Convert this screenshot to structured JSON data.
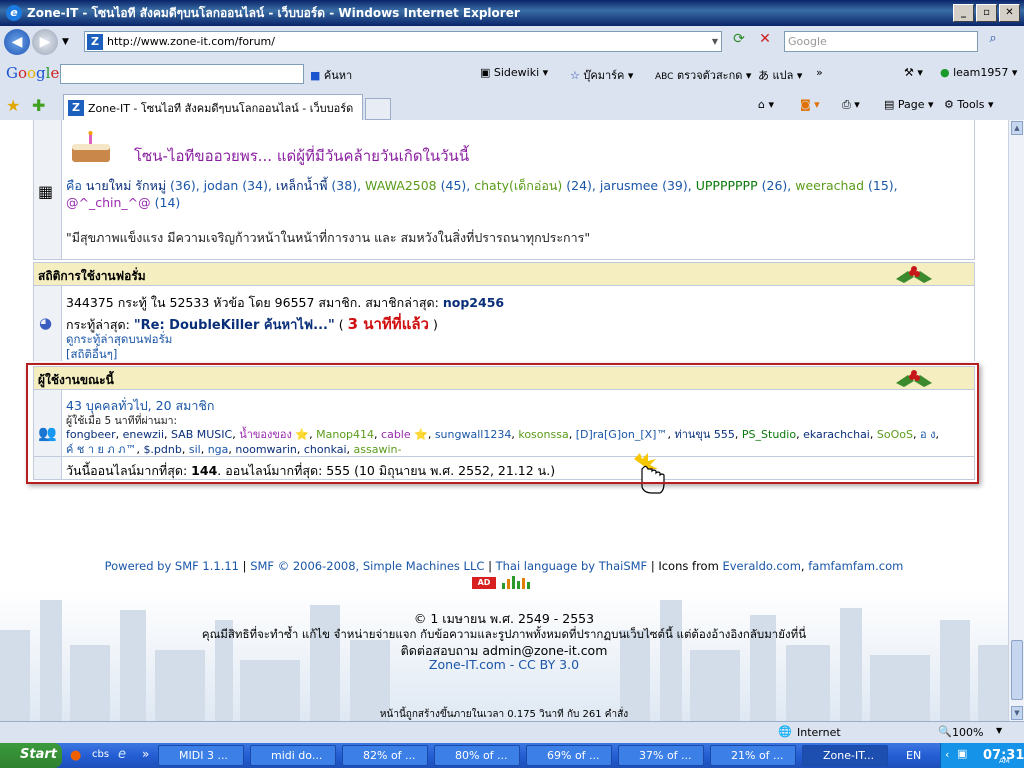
{
  "window": {
    "title": "Zone-IT - โซนไอที สังคมดีๆบนโลกออนไลน์ - เว็บบอร์ด - Windows Internet Explorer",
    "btns": [
      "_",
      "▫",
      "✕"
    ]
  },
  "address": {
    "url": "http://www.zone-it.com/forum/",
    "search_placeholder": "Google"
  },
  "gbar": {
    "logo": [
      "G",
      "o",
      "o",
      "g",
      "l",
      "e"
    ],
    "search": "ค้นหา",
    "sidewiki": "Sidewiki",
    "bookmarks": "บุ๊คมาร์ค",
    "spell": "ตรวจตัวสะกด",
    "translate": "แปล",
    "more": "»",
    "user": "leam1957"
  },
  "tabs": {
    "active": "Zone-IT - โซนไอที สังคมดีๆบนโลกออนไลน์ - เว็บบอร์ด",
    "page": "Page",
    "tools": "Tools"
  },
  "birthday": {
    "heading": "โซน-ไอทีขออวยพร... แด่ผู้ที่มีวันคล้ายวันเกิดในวันนี้",
    "intro": "คือ",
    "names": [
      {
        "t": "นายใหม่ รักหมู่",
        "n": "(36)",
        "c": "navy"
      },
      {
        "t": "jodan",
        "n": "(34)",
        "c": "link"
      },
      {
        "t": "เหล็กน้ำพี้",
        "n": "(38)",
        "c": "navy"
      },
      {
        "t": "WAWA2508",
        "n": "(45)",
        "c": "green"
      },
      {
        "t": "chaty(เด็กอ่อน)",
        "n": "(24)",
        "c": "green"
      },
      {
        "t": "jarusmee",
        "n": "(39)",
        "c": "link"
      },
      {
        "t": "UPPPPPPP",
        "n": "(26)",
        "c": "dgreen"
      },
      {
        "t": "weerachad",
        "n": "(15)",
        "c": "green"
      }
    ],
    "last_name": "@^_chin_^@",
    "last_count": "(14)",
    "wish": "\"มีสุขภาพแข็งแรง มีความเจริญก้าวหน้าในหน้าที่การงาน และ สมหวังในสิ่งที่ปรารถนาทุกประการ\""
  },
  "stats": {
    "heading": "สถิติการใช้งานฟอรั่ม",
    "line1": "344375 กระทู้ ใน 52533 หัวข้อ โดย 96557 สมาชิก. สมาชิกล่าสุด:",
    "latest_member": "nop2456",
    "latest_label": "กระทู้ล่าสุด:",
    "latest_post": "\"Re: DoubleKiller ค้นหาไฟ...\"",
    "paren_open": "(",
    "latest_time": "3 นาทีที่แล้ว",
    "paren_close": ")",
    "recent_link": "ดูกระทู้ล่าสุดบนฟอรั่ม",
    "more_link": "[สถิติอื่นๆ]"
  },
  "online": {
    "heading": "ผู้ใช้งานขณะนี้",
    "summary": "43 บุคคลทั่วไป, 20 สมาชิก",
    "subtitle": "ผู้ใช้เมื่อ 5 นาทีที่ผ่านมา:",
    "users1": [
      {
        "t": "fongbeer",
        "c": "navy"
      },
      {
        "t": "enewzii",
        "c": "navy"
      },
      {
        "t": "SAB MUSIC",
        "c": "navy"
      },
      {
        "t": "น้ำของของ ⭐",
        "c": "purple"
      },
      {
        "t": "Manop414",
        "c": "green"
      },
      {
        "t": "cable ⭐",
        "c": "purple"
      },
      {
        "t": "sungwall1234",
        "c": "link"
      },
      {
        "t": "kosonssa",
        "c": "green"
      },
      {
        "t": "[D]ra[G]on_[X]™",
        "c": "link"
      },
      {
        "t": "ท่านขุน 555",
        "c": "navy"
      },
      {
        "t": "PS_Studio",
        "c": "dgreen"
      },
      {
        "t": "ekarachchai",
        "c": "navy"
      },
      {
        "t": "SoOoS",
        "c": "green"
      },
      {
        "t": "อ ง",
        "c": "link"
      }
    ],
    "users2": [
      {
        "t": "ค์ ช า ย ภ ภ™",
        "c": "link"
      },
      {
        "t": "$.pdnb",
        "c": "navy"
      },
      {
        "t": "sil",
        "c": "link"
      },
      {
        "t": "nga",
        "c": "link"
      },
      {
        "t": "noomwarin",
        "c": "navy"
      },
      {
        "t": "chonkai",
        "c": "navy"
      },
      {
        "t": "assawin-",
        "c": "green"
      }
    ],
    "record_label": "วันนี้ออนไลน์มากที่สุด:",
    "record_today": "144",
    "record_rest": ". ออนไลน์มากที่สุด: 555 (10 มิถุนายน พ.ศ. 2552, 21.12 น.)"
  },
  "footer": {
    "powered": "Powered by SMF 1.1.11",
    "sep": "|",
    "smf": "SMF © 2006-2008, Simple Machines LLC",
    "thai": "Thai language by ThaiSMF",
    "icons": "Icons from",
    "everaldo": "Everaldo.com",
    "famfam": "famfamfam.com",
    "copyright": "© 1 เมษายน พ.ศ. 2549 - 2553",
    "rights": "คุณมีสิทธิที่จะทำซ้ำ แก้ไข จำหน่ายจ่ายแจก กับข้อความและรูปภาพทั้งหมดที่ปรากฏบนเว็บไซต์นี้ แต่ต้องอ้างอิงกลับมายังที่นี่",
    "contact": "ติดต่อสอบถาม admin@zone-it.com",
    "zone": "Zone-IT.com",
    "dash": "-",
    "cc": "CC BY 3.0",
    "time": "หน้านี้ถูกสร้างขึ้นภายในเวลา 0.175 วินาที กับ 261 คำสั่ง"
  },
  "statusbar": {
    "zone": "Internet",
    "zoom": "100%"
  },
  "taskbar": {
    "start": "Start",
    "items": [
      "MIDI 3 ...",
      "midi do...",
      "82% of ...",
      "80% of ...",
      "69% of ...",
      "37% of ...",
      "21% of ...",
      "Zone-IT..."
    ],
    "lang": "EN",
    "time": "07:31",
    "ampm": "AM"
  },
  "colors": {
    "navy": "#0a2f7a",
    "link": "#1a56a8",
    "green": "#5a9c1a",
    "dgreen": "#0a7a0a",
    "purple": "#9a2ab0"
  }
}
